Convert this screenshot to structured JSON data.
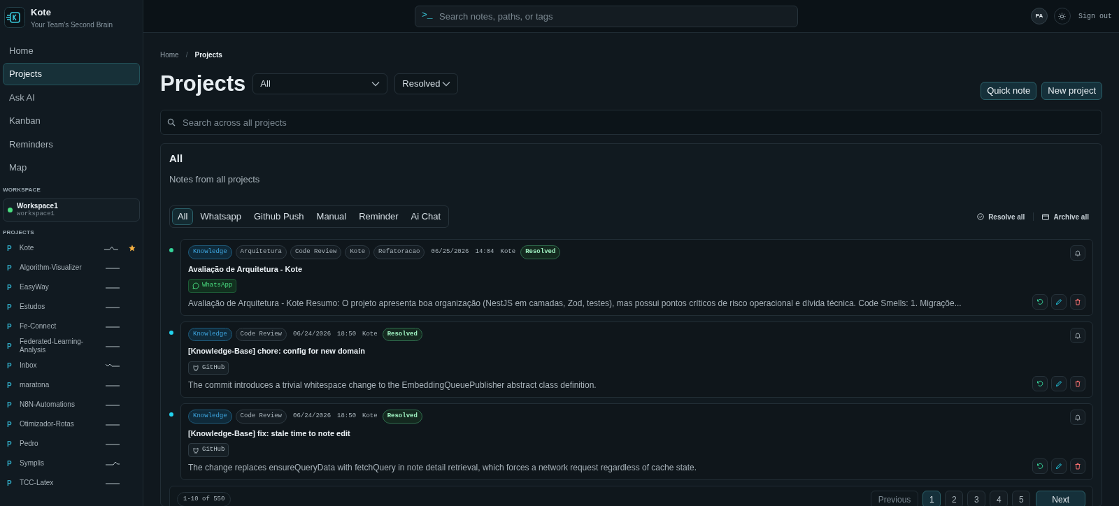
{
  "brand": {
    "name": "Kote",
    "tagline": "Your Team's Second Brain"
  },
  "nav": [
    {
      "label": "Home",
      "selected": false
    },
    {
      "label": "Projects",
      "selected": true
    },
    {
      "label": "Ask AI",
      "selected": false
    },
    {
      "label": "Kanban",
      "selected": false
    },
    {
      "label": "Reminders",
      "selected": false
    },
    {
      "label": "Map",
      "selected": false
    }
  ],
  "workspace": {
    "heading": "WORKSPACE",
    "name": "Workspace1",
    "slug": "workspace1",
    "color": "#4ade80"
  },
  "projects": {
    "heading": "PROJECTS",
    "items": [
      {
        "badge": "P",
        "name": "Kote",
        "kind": "peak",
        "starred": true
      },
      {
        "badge": "P",
        "name": "Algorithm-Visualizer",
        "kind": "flat",
        "starred": false
      },
      {
        "badge": "P",
        "name": "EasyWay",
        "kind": "flat",
        "starred": false
      },
      {
        "badge": "P",
        "name": "Estudos",
        "kind": "flat",
        "starred": false
      },
      {
        "badge": "P",
        "name": "Fe-Connect",
        "kind": "flat",
        "starred": false
      },
      {
        "badge": "P",
        "name": "Federated-Learning-Analysis",
        "kind": "flat",
        "starred": false
      },
      {
        "badge": "P",
        "name": "Inbox",
        "kind": "dip",
        "starred": false
      },
      {
        "badge": "P",
        "name": "maratona",
        "kind": "flat",
        "starred": false
      },
      {
        "badge": "P",
        "name": "N8N-Automations",
        "kind": "flat",
        "starred": false
      },
      {
        "badge": "P",
        "name": "Otimizador-Rotas",
        "kind": "flat",
        "starred": false
      },
      {
        "badge": "P",
        "name": "Pedro",
        "kind": "flat",
        "starred": false
      },
      {
        "badge": "P",
        "name": "Symplis",
        "kind": "rise",
        "starred": false
      },
      {
        "badge": "P",
        "name": "TCC-Latex",
        "kind": "flat",
        "starred": false
      }
    ]
  },
  "topbar": {
    "prompt": ">_",
    "search_placeholder": "Search notes, paths, or tags",
    "avatar": "PA",
    "sign_out": "Sign out"
  },
  "breadcrumb": {
    "items": [
      "Home",
      "Projects"
    ],
    "separator": "/"
  },
  "page": {
    "title": "Projects",
    "project_filter": "All",
    "status_filter": "Resolved",
    "buttons": [
      "Quick note",
      "New project"
    ],
    "search_placeholder": "Search across all projects"
  },
  "panel": {
    "title": "All",
    "subtitle": "Notes from all projects",
    "source_tabs": [
      {
        "label": "All",
        "selected": true
      },
      {
        "label": "Whatsapp",
        "selected": false
      },
      {
        "label": "Github Push",
        "selected": false
      },
      {
        "label": "Manual",
        "selected": false
      },
      {
        "label": "Reminder",
        "selected": false
      },
      {
        "label": "Ai Chat",
        "selected": false
      }
    ],
    "actions": [
      "Resolve all",
      "Archive all"
    ]
  },
  "notes": [
    {
      "color": "#34d399",
      "tags": [
        {
          "label": "Knowledge",
          "kind": "primary"
        },
        {
          "label": "Arquitetura",
          "kind": "plain"
        },
        {
          "label": "Code Review",
          "kind": "plain"
        },
        {
          "label": "Kote",
          "kind": "plain"
        },
        {
          "label": "Refatoracao",
          "kind": "plain"
        }
      ],
      "date": "06/25/2026",
      "time": "14:04",
      "project": "Kote",
      "status": "Resolved",
      "title": "Avaliação de Arquitetura - Kote",
      "source": {
        "kind": "whatsapp",
        "label": "WhatsApp"
      },
      "description": "Avaliação de Arquitetura - Kote Resumo: O projeto apresenta boa organização (NestJS em camadas, Zod, testes), mas possui pontos críticos de risco operacional e dívida técnica. Code Smells: 1. Migraçõe..."
    },
    {
      "color": "#22d3ee",
      "tags": [
        {
          "label": "Knowledge",
          "kind": "primary"
        },
        {
          "label": "Code Review",
          "kind": "plain"
        }
      ],
      "date": "06/24/2026",
      "time": "18:50",
      "project": "Kote",
      "status": "Resolved",
      "title": "[Knowledge-Base] chore: config for new domain",
      "source": {
        "kind": "github",
        "label": "GitHub"
      },
      "description": "The commit introduces a trivial whitespace change to the EmbeddingQueuePublisher abstract class definition."
    },
    {
      "color": "#22d3ee",
      "tags": [
        {
          "label": "Knowledge",
          "kind": "primary"
        },
        {
          "label": "Code Review",
          "kind": "plain"
        }
      ],
      "date": "06/24/2026",
      "time": "18:50",
      "project": "Kote",
      "status": "Resolved",
      "title": "[Knowledge-Base] fix: stale time to note edit",
      "source": {
        "kind": "github",
        "label": "GitHub"
      },
      "description": "The change replaces ensureQueryData with fetchQuery in note detail retrieval, which forces a network request regardless of cache state."
    }
  ],
  "pagination": {
    "range": "1-10 of 550",
    "previous": "Previous",
    "pages": [
      {
        "label": "1",
        "selected": true
      },
      {
        "label": "2",
        "selected": false
      },
      {
        "label": "3",
        "selected": false
      },
      {
        "label": "4",
        "selected": false
      },
      {
        "label": "5",
        "selected": false
      }
    ],
    "next": "Next"
  }
}
